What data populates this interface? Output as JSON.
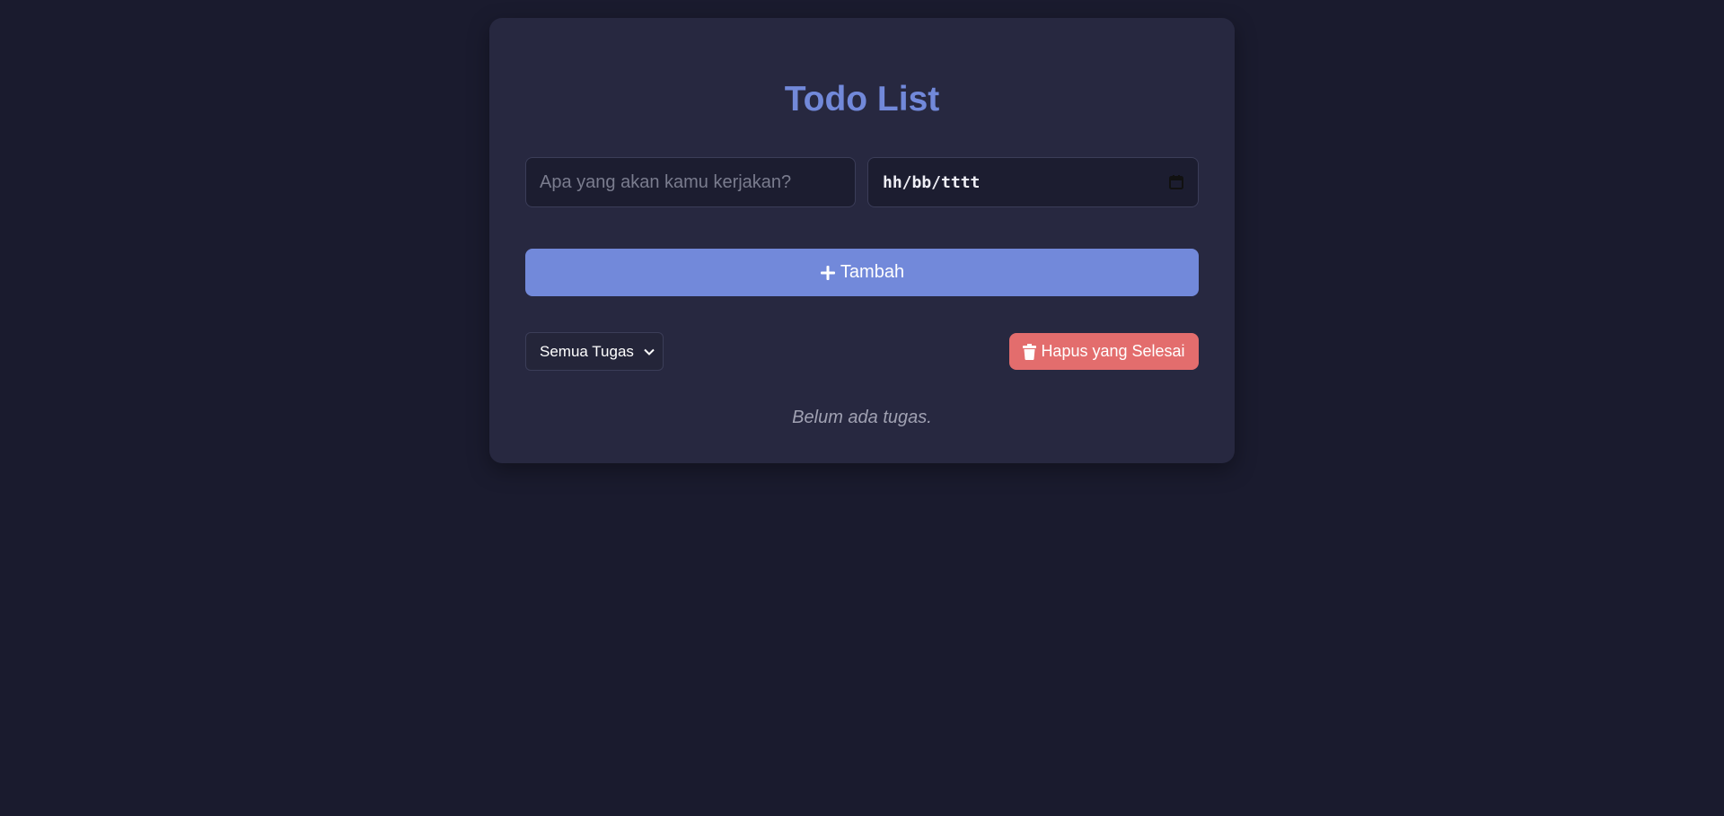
{
  "app": {
    "title": "Todo List"
  },
  "form": {
    "task_placeholder": "Apa yang akan kamu kerjakan?",
    "task_value": "",
    "date_display": "hh/bb/tttt",
    "add_label": "Tambah"
  },
  "filter": {
    "selected": "Semua Tugas"
  },
  "actions": {
    "clear_completed_label": "Hapus yang Selesai"
  },
  "list": {
    "empty_message": "Belum ada tugas."
  },
  "icons": {
    "add": "plus-icon",
    "date": "calendar-icon",
    "filter": "chevron-down-icon",
    "clear": "trash-icon"
  },
  "colors": {
    "background": "#1a1b2e",
    "card": "#272840",
    "accent": "#7289da",
    "danger": "#e36d6d",
    "input_bg": "#1c1d30",
    "muted_text": "#a0a1b2"
  }
}
